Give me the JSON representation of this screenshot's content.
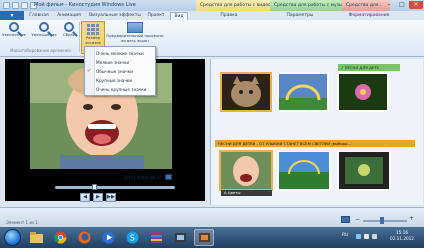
{
  "window": {
    "title": "Мой фильм - Киностудия Windows Live",
    "context_tabs": [
      "Средства для работы с видео",
      "Средства для работы с музыкой",
      "Средства для..."
    ],
    "controls": {
      "minimize": "–",
      "maximize": "□",
      "close": "✕"
    }
  },
  "ribbon": {
    "file_tab": "▾",
    "tabs": [
      "Главная",
      "Анимация",
      "Визуальные эффекты",
      "Проект",
      "Вид",
      "Правка",
      "Параметры",
      "Форматирование"
    ],
    "active_tab": "Вид",
    "buttons": {
      "zoom_in": "Увеличение",
      "zoom_out": "Уменьшение",
      "reset": "Сброс",
      "thumb_size": "Размер эскизов",
      "preview_full": "Предварительный просмотр во весь экран"
    },
    "group_label": "Масштабирование временно"
  },
  "thumbnail_menu": {
    "items": [
      "Очень мелкие значки",
      "Мелкие значки",
      "Обычные значки",
      "Крупные значки",
      "Очень крупные значки"
    ],
    "checked_index": 2
  },
  "player": {
    "time": "00:21,00/00:48,37",
    "progress": 0.33,
    "buttons": {
      "prev": "◀",
      "play": "▶",
      "next": "▶▶"
    }
  },
  "storyboard": {
    "music_caption": "♪ ПЕСНИ ДЛЯ ДЕТЕ",
    "title_clip_caption": "ПЕСНИ ДЛЯ ДЕТЕЙ - ОТ УЛЫБКИ СТАНЕТ ВСЕМ СВЕТЛЕЙ (выборо...",
    "clip_caption": "A Цветы"
  },
  "status": {
    "text": "Элемент 1 из 1",
    "zoom_out": "−",
    "zoom_in": "+"
  },
  "taskbar": {
    "lang": "RU",
    "time": "15:16",
    "date": "02.11.2012"
  },
  "colors": {
    "accent": "#2a6bb3",
    "music_bar": "#79c36a",
    "title_clip": "#e3a62d",
    "ctx_video": "#f2d87a",
    "ctx_music": "#94d38a",
    "ctx_format": "#e99c92"
  }
}
